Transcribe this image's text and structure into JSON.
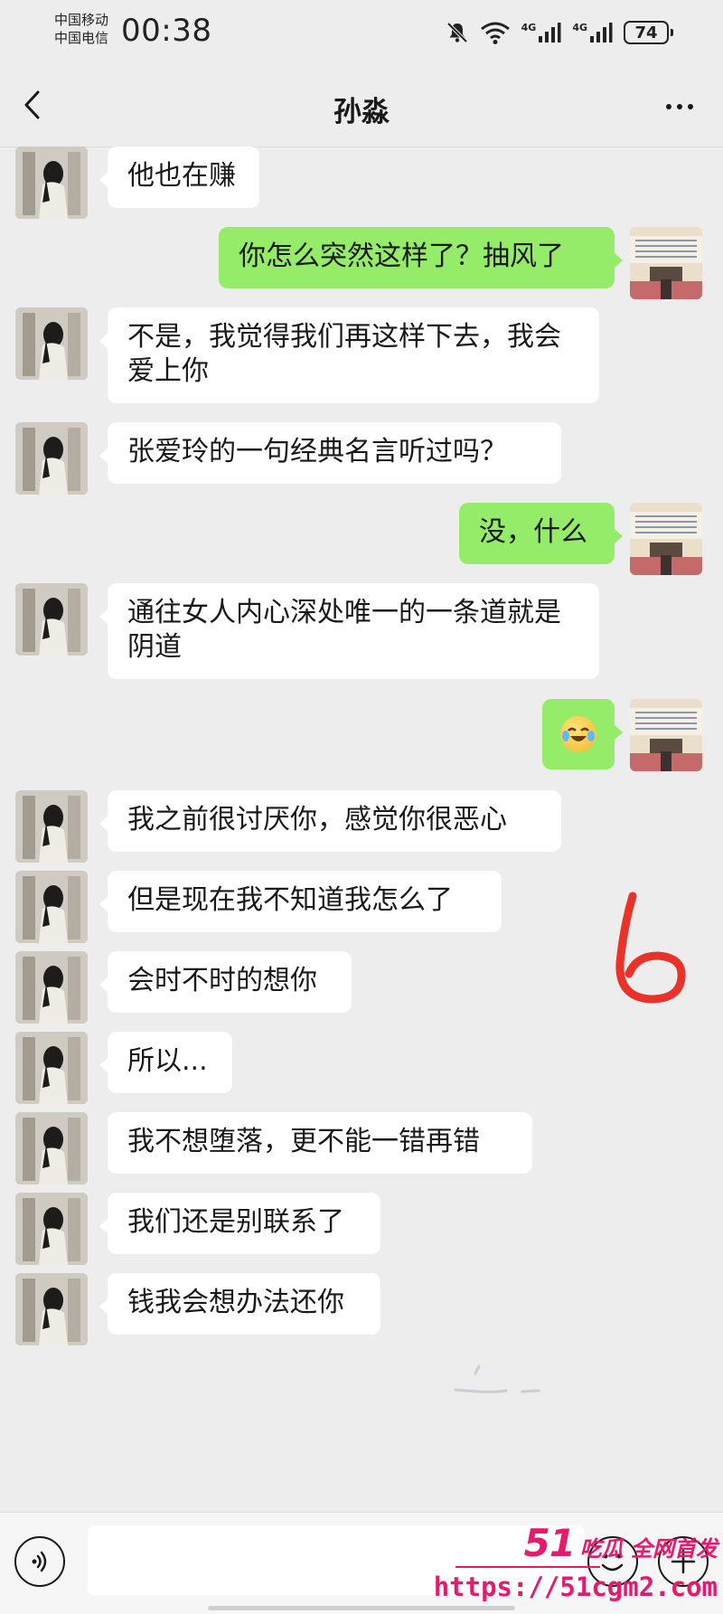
{
  "status_bar": {
    "carrier_1": "中国移动",
    "carrier_2": "中国电信",
    "time": "00:38",
    "network_1": "4G",
    "network_2": "4G",
    "battery": "74",
    "icons": [
      "bell-muted-icon",
      "wifi-icon",
      "signal-icon",
      "signal-icon",
      "battery-icon"
    ]
  },
  "header": {
    "title": "孙淼",
    "back_icon": "chevron-left-icon",
    "more_icon": "more-dots-icon"
  },
  "messages": [
    {
      "side": "left",
      "text": "他也在赚"
    },
    {
      "side": "right",
      "text": "你怎么突然这样了？抽风了"
    },
    {
      "side": "left",
      "text": "不是，我觉得我们再这样下去，我会爱上你"
    },
    {
      "side": "left",
      "text": "张爱玲的一句经典名言听过吗？"
    },
    {
      "side": "right",
      "text": "没，什么"
    },
    {
      "side": "left",
      "text": "通往女人内心深处唯一的一条道就是阴道"
    },
    {
      "side": "right",
      "emoji": "laughing-crying-emoji"
    },
    {
      "side": "left",
      "text": "我之前很讨厌你，感觉你很恶心"
    },
    {
      "side": "left",
      "text": "但是现在我不知道我怎么了"
    },
    {
      "side": "left",
      "text": "会时不时的想你"
    },
    {
      "side": "left",
      "text": "所以..."
    },
    {
      "side": "left",
      "text": "我不想堕落，更不能一错再错"
    },
    {
      "side": "left",
      "text": "我们还是别联系了"
    },
    {
      "side": "left",
      "text": "钱我会想办法还你"
    }
  ],
  "annotation": {
    "mark": "6",
    "color": "#e8322a"
  },
  "input_bar": {
    "placeholder": "",
    "voice_icon": "voice-icon",
    "emoji_icon": "emoji-icon",
    "plus_icon": "plus-icon"
  },
  "watermark": {
    "num": "51",
    "cn": "吃瓜 全网首发",
    "url": "https://51cgm2.com",
    "color": "#e8186d"
  },
  "colors": {
    "background": "#ededed",
    "incoming_bubble": "#ffffff",
    "outgoing_bubble": "#95ec69"
  }
}
